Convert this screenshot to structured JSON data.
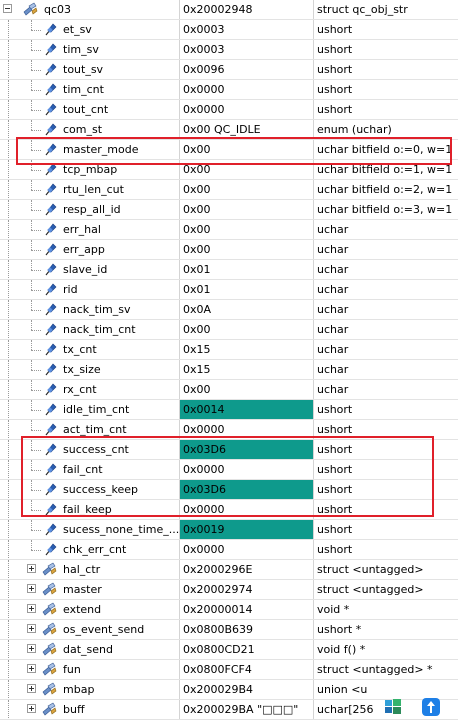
{
  "rows": [
    {
      "name": "qc03",
      "value": "0x20002948",
      "type": "struct qc_obj_str",
      "kind": "root"
    },
    {
      "name": "et_sv",
      "value": "0x0003",
      "type": "ushort",
      "kind": "field"
    },
    {
      "name": "tim_sv",
      "value": "0x0003",
      "type": "ushort",
      "kind": "field"
    },
    {
      "name": "tout_sv",
      "value": "0x0096",
      "type": "ushort",
      "kind": "field"
    },
    {
      "name": "tim_cnt",
      "value": "0x0000",
      "type": "ushort",
      "kind": "field"
    },
    {
      "name": "tout_cnt",
      "value": "0x0000",
      "type": "ushort",
      "kind": "field"
    },
    {
      "name": "com_st",
      "value": "0x00 QC_IDLE",
      "type": "enum (uchar)",
      "kind": "field"
    },
    {
      "name": "master_mode",
      "value": "0x00",
      "type": "uchar bitfield o:=0, w=1",
      "kind": "field"
    },
    {
      "name": "tcp_mbap",
      "value": "0x00",
      "type": "uchar bitfield o:=1, w=1",
      "kind": "field"
    },
    {
      "name": "rtu_len_cut",
      "value": "0x00",
      "type": "uchar bitfield o:=2, w=1",
      "kind": "field"
    },
    {
      "name": "resp_all_id",
      "value": "0x00",
      "type": "uchar bitfield o:=3, w=1",
      "kind": "field"
    },
    {
      "name": "err_hal",
      "value": "0x00",
      "type": "uchar",
      "kind": "field"
    },
    {
      "name": "err_app",
      "value": "0x00",
      "type": "uchar",
      "kind": "field"
    },
    {
      "name": "slave_id",
      "value": "0x01",
      "type": "uchar",
      "kind": "field"
    },
    {
      "name": "rid",
      "value": "0x01",
      "type": "uchar",
      "kind": "field"
    },
    {
      "name": "nack_tim_sv",
      "value": "0x0A",
      "type": "uchar",
      "kind": "field"
    },
    {
      "name": "nack_tim_cnt",
      "value": "0x00",
      "type": "uchar",
      "kind": "field"
    },
    {
      "name": "tx_cnt",
      "value": "0x15",
      "type": "uchar",
      "kind": "field"
    },
    {
      "name": "tx_size",
      "value": "0x15",
      "type": "uchar",
      "kind": "field"
    },
    {
      "name": "rx_cnt",
      "value": "0x00",
      "type": "uchar",
      "kind": "field"
    },
    {
      "name": "idle_tim_cnt",
      "value": "0x0014",
      "type": "ushort",
      "kind": "field",
      "highlight": true
    },
    {
      "name": "act_tim_cnt",
      "value": "0x0000",
      "type": "ushort",
      "kind": "field"
    },
    {
      "name": "success_cnt",
      "value": "0x03D6",
      "type": "ushort",
      "kind": "field",
      "highlight": true
    },
    {
      "name": "fail_cnt",
      "value": "0x0000",
      "type": "ushort",
      "kind": "field"
    },
    {
      "name": "success_keep",
      "value": "0x03D6",
      "type": "ushort",
      "kind": "field",
      "highlight": true
    },
    {
      "name": "fail_keep",
      "value": "0x0000",
      "type": "ushort",
      "kind": "field"
    },
    {
      "name": "sucess_none_time_...",
      "value": "0x0019",
      "type": "ushort",
      "kind": "field",
      "highlight": true
    },
    {
      "name": "chk_err_cnt",
      "value": "0x0000",
      "type": "ushort",
      "kind": "field"
    },
    {
      "name": "hal_ctr",
      "value": "0x2000296E",
      "type": "struct <untagged>",
      "kind": "struct"
    },
    {
      "name": "master",
      "value": "0x20002974",
      "type": "struct <untagged>",
      "kind": "struct"
    },
    {
      "name": "extend",
      "value": "0x20000014",
      "type": "void *",
      "kind": "struct"
    },
    {
      "name": "os_event_send",
      "value": "0x0800B639",
      "type": "ushort *",
      "kind": "struct"
    },
    {
      "name": "dat_send",
      "value": "0x0800CD21",
      "type": "void f()  *",
      "kind": "struct"
    },
    {
      "name": "fun",
      "value": "0x0800FCF4",
      "type": "struct <untagged> *",
      "kind": "struct"
    },
    {
      "name": "mbap",
      "value": "0x200029B4",
      "type": "union <u",
      "kind": "struct"
    },
    {
      "name": "buff",
      "value": "0x200029BA \"□□□\"",
      "type": "uchar[256",
      "kind": "struct"
    }
  ],
  "colors": {
    "highlight": "#0e9a8c",
    "annotation_box": "#e0202a",
    "pin_icon": "#2a5db0",
    "struct_icon": "#6a8fc7"
  },
  "icons": {
    "field": "field-pin-icon",
    "struct": "struct-icon",
    "expand": "expand-plus-icon",
    "collapse": "collapse-minus-icon",
    "overlay_left": "windows-logo-icon",
    "overlay_right": "app-logo-icon"
  }
}
